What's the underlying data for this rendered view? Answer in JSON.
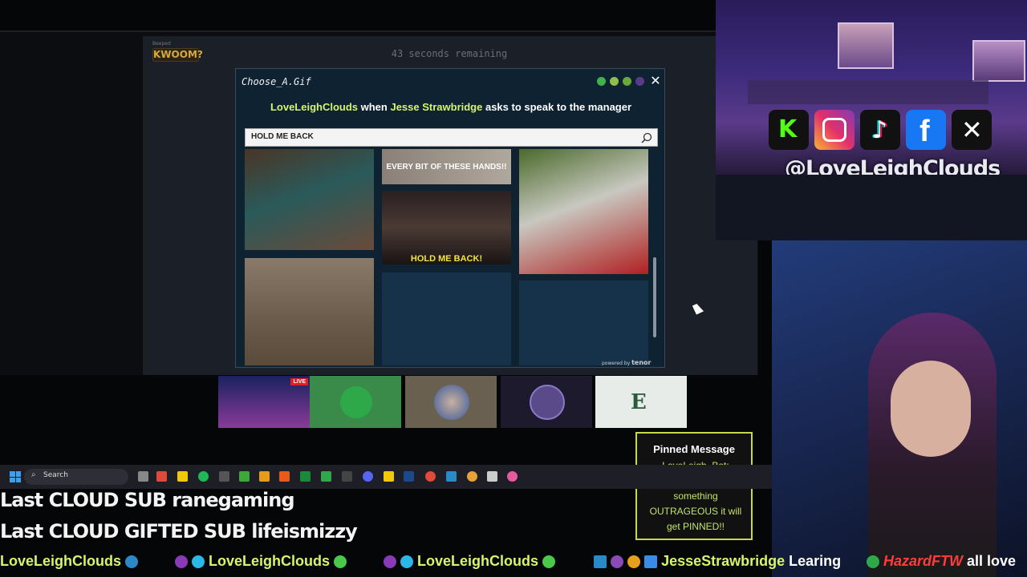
{
  "game": {
    "logo": "KWOOM?",
    "logo_sub": "Beeped",
    "timer": "43 seconds remaining"
  },
  "dialog": {
    "title": "Choose_A.Gif",
    "prompt": {
      "user": "LoveLeighClouds",
      "mid1": " when ",
      "other": "Jesse Strawbridge",
      "mid2": " asks to speak to the manager"
    },
    "search_value": "HOLD ME BACK",
    "gifs": [
      {
        "caption": ""
      },
      {
        "caption": "EVERY BIT OF THESE HANDS!!"
      },
      {
        "caption": "HOLD ME BACK!"
      },
      {
        "caption": ""
      },
      {
        "caption": ""
      }
    ],
    "powered_by": "powered by",
    "tenor": "tenor"
  },
  "stream": {
    "handle": "@LoveLeighClouds",
    "live_badge": "LIVE",
    "socials": [
      "kick-icon",
      "instagram-icon",
      "tiktok-icon",
      "facebook-icon",
      "x-icon"
    ]
  },
  "pinned": {
    "title": "Pinned Message",
    "body": "LoveLeigh_Bot: WARNING If you say something OUTRAGEOUS it will get PINNED!!"
  },
  "taskbar": {
    "search_placeholder": "Search"
  },
  "overlay": {
    "last_sub": "Last CLOUD SUB ranegaming",
    "last_gifted": "Last CLOUD GIFTED SUB lifeismizzy",
    "ticker": [
      {
        "text": "LoveLeighClouds"
      },
      {
        "text": "LoveLeighClouds"
      },
      {
        "text": "LoveLeighClouds"
      },
      {
        "text": "JesseStrawbridge",
        "rest": " Learing"
      },
      {
        "text": "HazardFTW",
        "rest": " all love"
      }
    ]
  },
  "colors": {
    "accent": "#d6f56c",
    "dialog_bg": "#0e2232",
    "hazard": "#ff3b3b"
  }
}
